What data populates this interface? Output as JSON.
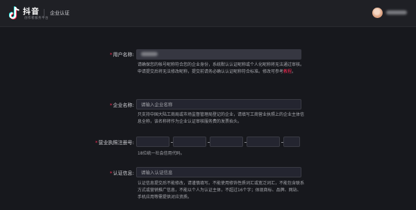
{
  "header": {
    "brand_name": "抖音",
    "brand_sub": "创作者服务平台",
    "page_title": "企业认证",
    "colors": {
      "background": "#1f2025",
      "accent": "#fe2c55"
    }
  },
  "form": {
    "username": {
      "label": "用户名称:",
      "hint_text": "请确保您的帐号昵称符合您的企业身份，系统默认认证昵称或个人化昵称将无法通过审核。申请提交后将无法修改昵称，提交前请务必确认认证昵称符合标准。修改可参考",
      "hint_link": "教程",
      "hint_end": "。"
    },
    "company_name": {
      "label": "企业名称:",
      "placeholder": "请输入企业名称",
      "hint": "只支持中国大陆工商局或市场监督管理局登记的企业，请填写工商营业执照上的企业主体信息全称，该名称将作为企业认证审核服务费的发票抬头。"
    },
    "license_number": {
      "label": "营业执照注册号:",
      "hint": "18位统一社会信用代码。"
    },
    "cert_info": {
      "label": "认证信息:",
      "placeholder": "请输入认证信息",
      "hint": "认证信息提交后不能修改，请谨慎填写。不能使用修饰性质词汇或宽泛词汇，不能包含联系方式或营销推广信息，不能以个人为认证主体，不超过16个字；体现商标、品牌、网站、手机应用等需提供对应资质。"
    },
    "required_mark": "*"
  }
}
